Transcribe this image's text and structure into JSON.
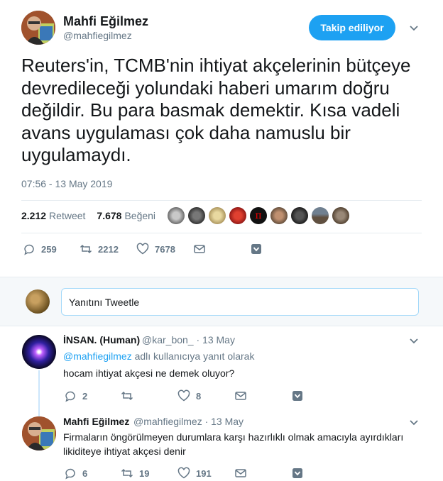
{
  "main_tweet": {
    "author_name": "Mahfi Eğilmez",
    "author_handle": "@mahfiegilmez",
    "follow_label": "Takip ediliyor",
    "text": "Reuters'in, TCMB'nin ihtiyat akçelerinin bütçeye devredileceği yolundaki haberi umarım doğru değildir. Bu para basmak demektir. Kısa vadeli avans uygulaması çok daha namuslu bir uygulamaydı.",
    "timestamp": "07:56 - 13 May 2019",
    "retweet_count": "2.212",
    "retweet_label": "Retweet",
    "like_count": "7.678",
    "like_label": "Beğeni",
    "actions": {
      "reply_count": "259",
      "retweet_count": "2212",
      "like_count": "7678"
    }
  },
  "reply_box": {
    "placeholder": "Yanıtını Tweetle"
  },
  "replies": [
    {
      "author_name": "İNSAN. (Human)",
      "author_handle": "@kar_bon_",
      "date": "13 May",
      "reply_to_handle": "@mahfiegilmez",
      "reply_to_suffix": "adlı kullanıcıya yanıt olarak",
      "text": "hocam ihtiyat akçesi ne demek oluyor?",
      "reply_count": "2",
      "retweet_count": "",
      "like_count": "8"
    },
    {
      "author_name": "Mahfi Eğilmez",
      "author_handle": "@mahfiegilmez",
      "date": "13 May",
      "text": "Firmaların öngörülmeyen durumlara karşı hazırlıklı olmak amacıyla ayırdıkları likiditeye ihtiyat akçesi denir",
      "reply_count": "6",
      "retweet_count": "19",
      "like_count": "191"
    }
  ],
  "separator": "·",
  "colors": {
    "accent": "#1da1f2",
    "secondary_text": "#657786",
    "divider": "#e6ecf0",
    "thread_line": "#cce6fb"
  }
}
